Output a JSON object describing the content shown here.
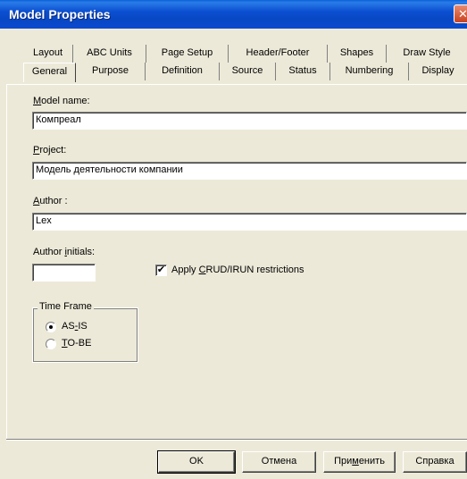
{
  "window": {
    "title": "Model Properties",
    "close_glyph": "✕"
  },
  "tabs": {
    "back_row": [
      "Layout",
      "ABC Units",
      "Page Setup",
      "Header/Footer",
      "Shapes",
      "Draw Style"
    ],
    "front_row": [
      "General",
      "Purpose",
      "Definition",
      "Source",
      "Status",
      "Numbering",
      "Display"
    ],
    "active": "General"
  },
  "form": {
    "model_name_label_u": "M",
    "model_name_label_rest": "odel name:",
    "model_name_value": "Компреал",
    "project_label_u": "P",
    "project_label_rest": "roject:",
    "project_value": "Модель деятельности компании",
    "author_label_u": "A",
    "author_label_rest": "uthor :",
    "author_value": "Lex",
    "initials_label_pre": "Author ",
    "initials_label_u": "i",
    "initials_label_rest": "nitials:",
    "initials_value": "",
    "crud_checked": true,
    "crud_label_pre": "Apply ",
    "crud_label_u": "C",
    "crud_label_rest": "RUD/IRUN restrictions"
  },
  "time_frame": {
    "legend": "Time Frame",
    "options": [
      {
        "pre": "AS",
        "u": "-",
        "rest": "IS",
        "selected": true
      },
      {
        "pre": "",
        "u": "T",
        "rest": "O-BE",
        "selected": false
      }
    ]
  },
  "buttons": {
    "ok": "OK",
    "cancel": "Отмена",
    "apply_pre": "При",
    "apply_u": "м",
    "apply_rest": "енить",
    "help": "Справка"
  }
}
